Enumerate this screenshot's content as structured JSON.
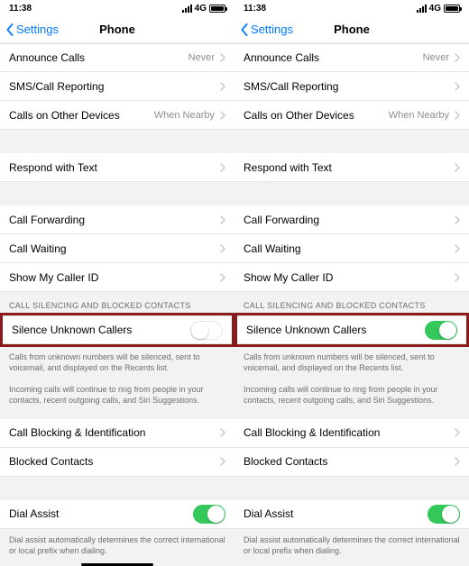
{
  "statusbar": {
    "time": "11:38",
    "net": "4G"
  },
  "navbar": {
    "back": "Settings",
    "title": "Phone"
  },
  "rows": {
    "announce": {
      "label": "Announce Calls",
      "value": "Never"
    },
    "sms": {
      "label": "SMS/Call Reporting"
    },
    "otherdev": {
      "label": "Calls on Other Devices",
      "value": "When Nearby"
    },
    "respond": {
      "label": "Respond with Text"
    },
    "forward": {
      "label": "Call Forwarding"
    },
    "waiting": {
      "label": "Call Waiting"
    },
    "callerid": {
      "label": "Show My Caller ID"
    },
    "silence": {
      "label": "Silence Unknown Callers"
    },
    "blocking": {
      "label": "Call Blocking & Identification"
    },
    "blocked": {
      "label": "Blocked Contacts"
    },
    "dial": {
      "label": "Dial Assist"
    }
  },
  "sections": {
    "silencing_header": "CALL SILENCING AND BLOCKED CONTACTS",
    "silence_footer1": "Calls from unknown numbers will be silenced, sent to voicemail, and displayed on the Recents list.",
    "silence_footer2": "Incoming calls will continue to ring from people in your contacts, recent outgoing calls, and Siri Suggestions.",
    "dial_footer": "Dial assist automatically determines the correct international or local prefix when dialing."
  }
}
